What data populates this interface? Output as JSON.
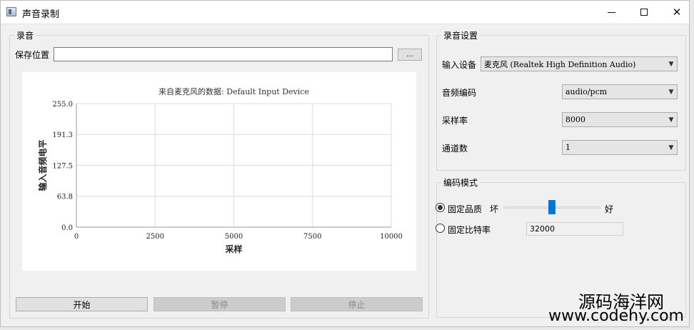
{
  "window": {
    "title": "声音录制"
  },
  "record_group": {
    "title": "录音",
    "save_location_label": "保存位置",
    "save_location_value": "",
    "browse_label": "...",
    "buttons": {
      "start": "开始",
      "pause": "暂停",
      "stop": "停止"
    }
  },
  "chart_data": {
    "type": "line",
    "title": "来自麦克风的数据: Default Input Device",
    "xlabel": "采样",
    "ylabel": "输入音频电平",
    "xlim": [
      0,
      10000
    ],
    "ylim": [
      0.0,
      255.0
    ],
    "xticks": [
      "0",
      "2500",
      "5000",
      "7500",
      "10000"
    ],
    "yticks": [
      "0.0",
      "63.8",
      "127.5",
      "191.3",
      "255.0"
    ],
    "grid": true,
    "series": []
  },
  "settings_group": {
    "title": "录音设置",
    "input_device_label": "输入设备",
    "input_device_value": "麦克风 (Realtek High Definition Audio)",
    "codec_label": "音频编码",
    "codec_value": "audio/pcm",
    "sample_rate_label": "采样率",
    "sample_rate_value": "8000",
    "channels_label": "通道数",
    "channels_value": "1"
  },
  "encoding_group": {
    "title": "编码模式",
    "constant_quality_label": "固定品质",
    "quality_low": "坏",
    "quality_high": "好",
    "quality_level": 0.5,
    "constant_bitrate_label": "固定比特率",
    "bitrate_value": "32000",
    "selected": "constant_quality"
  },
  "watermark": {
    "line1": "源码海洋网",
    "line2": "www.codehy.com"
  },
  "colors": {
    "accent": "#0078d7",
    "grid": "#dcdcdc"
  }
}
